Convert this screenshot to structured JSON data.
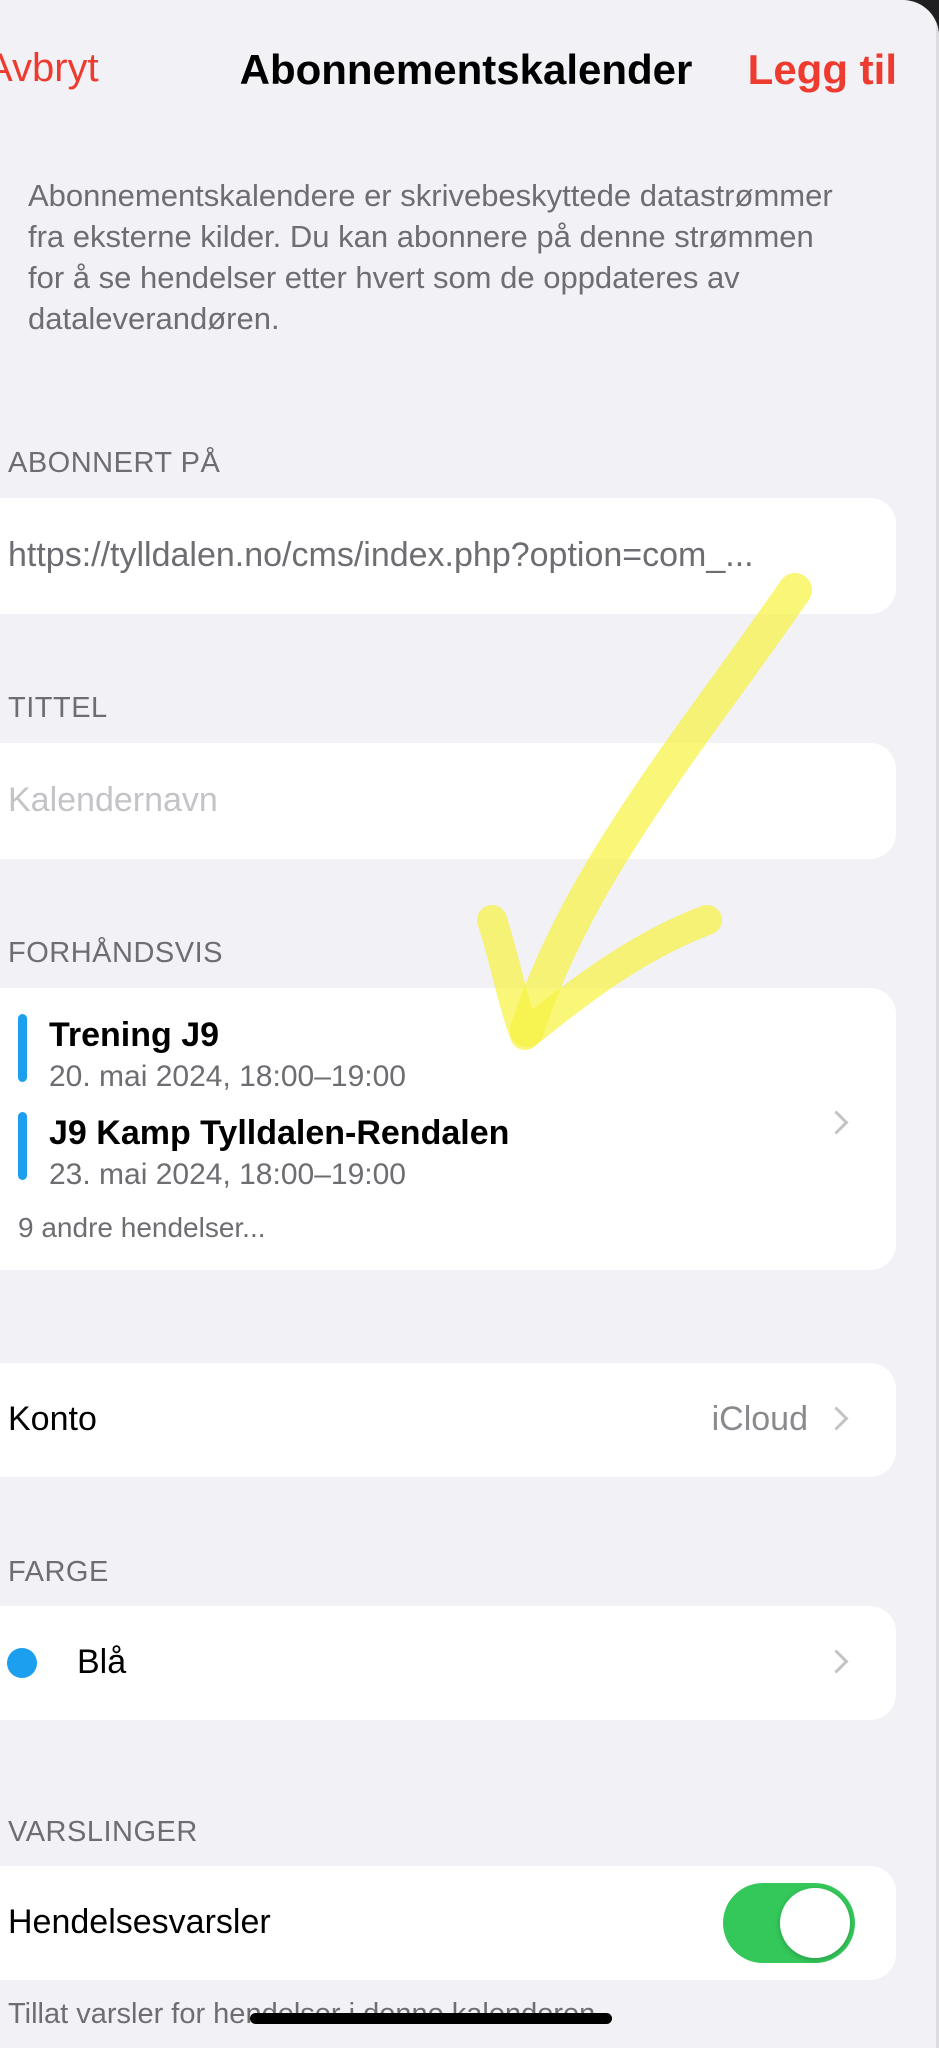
{
  "nav": {
    "cancel": "Avbryt",
    "title": "Abonnementskalender",
    "add": "Legg til"
  },
  "description": "Abonnementskalendere er skrivebeskyttede datastrømmer fra eksterne kilder. Du kan abonnere på denne strømmen for å se hendelser etter hvert som de oppdateres av dataleverandøren.",
  "subscribed": {
    "header": "ABONNERT PÅ",
    "url": "https://tylldalen.no/cms/index.php?option=com_..."
  },
  "title_section": {
    "header": "TITTEL",
    "placeholder": "Kalendernavn"
  },
  "preview": {
    "header": "FORHÅNDSVIS",
    "events": [
      {
        "title": "Trening J9",
        "time": "20. mai 2024, 18:00–19:00"
      },
      {
        "title": "J9 Kamp Tylldalen-Rendalen",
        "time": "23. mai 2024, 18:00–19:00"
      }
    ],
    "more": "9 andre hendelser..."
  },
  "account": {
    "label": "Konto",
    "value": "iCloud"
  },
  "color": {
    "header": "FARGE",
    "label": "Blå",
    "swatch": "#1d9ff0"
  },
  "alerts": {
    "header": "VARSLINGER",
    "label": "Hendelsesvarsler",
    "enabled": true,
    "footer": "Tillat varsler for hendelser i denne kalenderen."
  },
  "colors": {
    "accent": "#ee3b30",
    "toggle_on": "#34c759",
    "event_bar": "#1d9ff0"
  }
}
